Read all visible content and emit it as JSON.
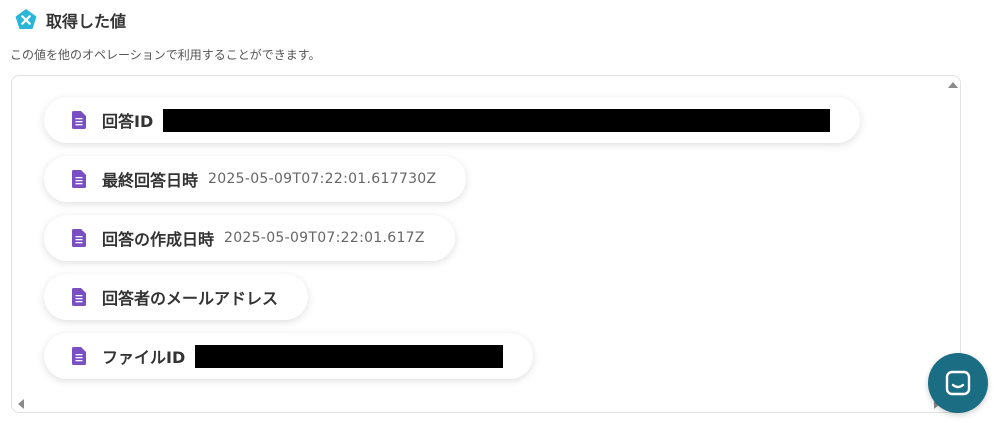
{
  "header": {
    "title": "取得した値",
    "description": "この値を他のオペレーションで利用することができます。"
  },
  "items": [
    {
      "label": "回答ID",
      "value": "",
      "redacted": true
    },
    {
      "label": "最終回答日時",
      "value": "2025-05-09T07:22:01.617730Z",
      "redacted": false
    },
    {
      "label": "回答の作成日時",
      "value": "2025-05-09T07:22:01.617Z",
      "redacted": false
    },
    {
      "label": "回答者のメールアドレス",
      "value": "",
      "redacted": false
    },
    {
      "label": "ファイルID",
      "value": "",
      "redacted": true
    }
  ],
  "colors": {
    "badge": "#2ab6d9",
    "doc_icon": "#7b4fc4",
    "chat_button": "#1a6d82"
  },
  "icons": {
    "header": "close-x-badge-icon",
    "item": "google-forms-doc-icon",
    "chat": "chat-bubble-icon"
  }
}
